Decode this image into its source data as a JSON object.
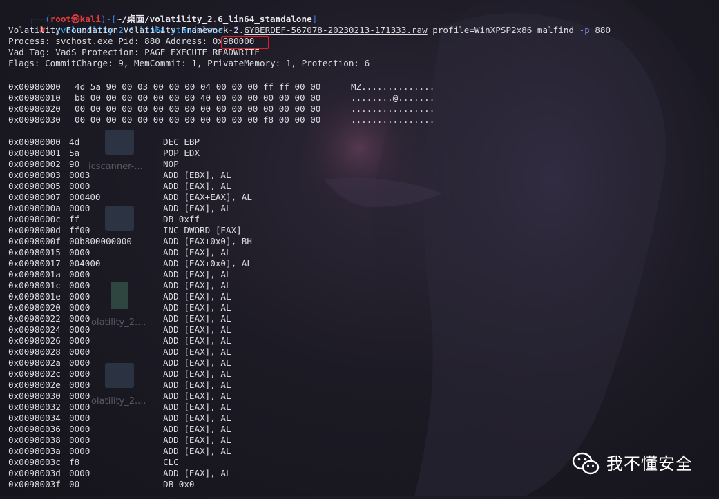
{
  "prompt": {
    "bracket_open": "┌──(",
    "user": "root㉿kali",
    "bracket_close": ")-[",
    "cwd": "~/桌面/volatility_2.6_lin64_standalone",
    "end_bracket": "]",
    "line2_prefix": "└─",
    "hash": "#"
  },
  "command": {
    "exe": "./volatility_2.6_lin64_standalone",
    "flag_f": "-f",
    "file": "CYBERDEF-567078-20230213-171333.raw",
    "profile": "profile=WinXPSP2x86",
    "plugin": "malfind",
    "flag_p": "-p",
    "pid": "880"
  },
  "output": {
    "banner": "Volatility Foundation Volatility Framework 2.6",
    "process_prefix": "Process: svchost.exe Pid: 880 Address: ",
    "process_address": "0x980000",
    "vad": "Vad Tag: VadS Protection: PAGE_EXECUTE_READWRITE",
    "flags": "Flags: CommitCharge: 9, MemCommit: 1, PrivateMemory: 1, Protection: 6"
  },
  "hexdump": [
    {
      "addr": "0x00980000",
      "bytes": "4d 5a 90 00 03 00 00 00 04 00 00 00 ff ff 00 00",
      "ascii": "MZ.............."
    },
    {
      "addr": "0x00980010",
      "bytes": "b8 00 00 00 00 00 00 00 40 00 00 00 00 00 00 00",
      "ascii": "........@......."
    },
    {
      "addr": "0x00980020",
      "bytes": "00 00 00 00 00 00 00 00 00 00 00 00 00 00 00 00",
      "ascii": "................"
    },
    {
      "addr": "0x00980030",
      "bytes": "00 00 00 00 00 00 00 00 00 00 00 00 f8 00 00 00",
      "ascii": "................"
    }
  ],
  "disasm": [
    {
      "addr": "0x00980000",
      "hex": "4d",
      "asm": "DEC EBP"
    },
    {
      "addr": "0x00980001",
      "hex": "5a",
      "asm": "POP EDX"
    },
    {
      "addr": "0x00980002",
      "hex": "90",
      "asm": "NOP"
    },
    {
      "addr": "0x00980003",
      "hex": "0003",
      "asm": "ADD [EBX], AL"
    },
    {
      "addr": "0x00980005",
      "hex": "0000",
      "asm": "ADD [EAX], AL"
    },
    {
      "addr": "0x00980007",
      "hex": "000400",
      "asm": "ADD [EAX+EAX], AL"
    },
    {
      "addr": "0x0098000a",
      "hex": "0000",
      "asm": "ADD [EAX], AL"
    },
    {
      "addr": "0x0098000c",
      "hex": "ff",
      "asm": "DB 0xff"
    },
    {
      "addr": "0x0098000d",
      "hex": "ff00",
      "asm": "INC DWORD [EAX]"
    },
    {
      "addr": "0x0098000f",
      "hex": "00b800000000",
      "asm": "ADD [EAX+0x0], BH"
    },
    {
      "addr": "0x00980015",
      "hex": "0000",
      "asm": "ADD [EAX], AL"
    },
    {
      "addr": "0x00980017",
      "hex": "004000",
      "asm": "ADD [EAX+0x0], AL"
    },
    {
      "addr": "0x0098001a",
      "hex": "0000",
      "asm": "ADD [EAX], AL"
    },
    {
      "addr": "0x0098001c",
      "hex": "0000",
      "asm": "ADD [EAX], AL"
    },
    {
      "addr": "0x0098001e",
      "hex": "0000",
      "asm": "ADD [EAX], AL"
    },
    {
      "addr": "0x00980020",
      "hex": "0000",
      "asm": "ADD [EAX], AL"
    },
    {
      "addr": "0x00980022",
      "hex": "0000",
      "asm": "ADD [EAX], AL"
    },
    {
      "addr": "0x00980024",
      "hex": "0000",
      "asm": "ADD [EAX], AL"
    },
    {
      "addr": "0x00980026",
      "hex": "0000",
      "asm": "ADD [EAX], AL"
    },
    {
      "addr": "0x00980028",
      "hex": "0000",
      "asm": "ADD [EAX], AL"
    },
    {
      "addr": "0x0098002a",
      "hex": "0000",
      "asm": "ADD [EAX], AL"
    },
    {
      "addr": "0x0098002c",
      "hex": "0000",
      "asm": "ADD [EAX], AL"
    },
    {
      "addr": "0x0098002e",
      "hex": "0000",
      "asm": "ADD [EAX], AL"
    },
    {
      "addr": "0x00980030",
      "hex": "0000",
      "asm": "ADD [EAX], AL"
    },
    {
      "addr": "0x00980032",
      "hex": "0000",
      "asm": "ADD [EAX], AL"
    },
    {
      "addr": "0x00980034",
      "hex": "0000",
      "asm": "ADD [EAX], AL"
    },
    {
      "addr": "0x00980036",
      "hex": "0000",
      "asm": "ADD [EAX], AL"
    },
    {
      "addr": "0x00980038",
      "hex": "0000",
      "asm": "ADD [EAX], AL"
    },
    {
      "addr": "0x0098003a",
      "hex": "0000",
      "asm": "ADD [EAX], AL"
    },
    {
      "addr": "0x0098003c",
      "hex": "f8",
      "asm": "CLC"
    },
    {
      "addr": "0x0098003d",
      "hex": "0000",
      "asm": "ADD [EAX], AL"
    },
    {
      "addr": "0x0098003f",
      "hex": "00",
      "asm": "DB 0x0"
    }
  ],
  "desktop_labels": [
    "icscanner-...",
    "olatility_2....",
    "olatility_2...."
  ],
  "watermark": {
    "icon": "wechat-icon",
    "text": "我不懂安全"
  },
  "colors": {
    "highlight_box": "#e02020",
    "prompt_user": "#e43c3c",
    "prompt_frame": "#3b78d8",
    "command_path": "#2aa4ff"
  }
}
